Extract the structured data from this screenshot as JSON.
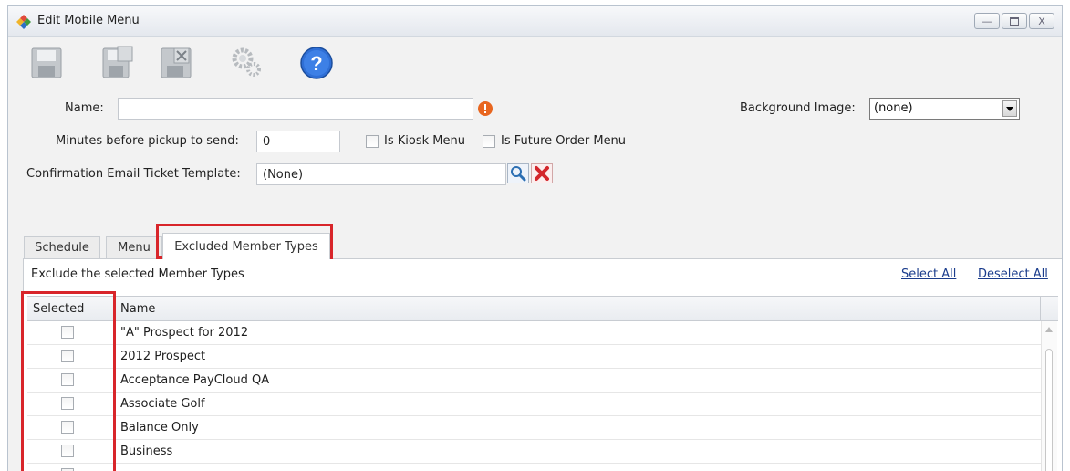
{
  "window": {
    "title": "Edit Mobile Menu",
    "buttons": [
      "minimize",
      "maximize",
      "close"
    ]
  },
  "toolbar": {
    "icons": [
      "save-icon",
      "save-new-icon",
      "save-close-icon",
      "settings-icon",
      "help-icon"
    ],
    "help_glyph": "?"
  },
  "form": {
    "name_label": "Name:",
    "name_value": "",
    "bg_label": "Background Image:",
    "bg_value": "(none)",
    "minutes_label": "Minutes before pickup to send:",
    "minutes_value": "0",
    "kiosk_label": "Is Kiosk Menu",
    "future_label": "Is Future Order Menu",
    "email_label": "Confirmation Email Ticket Template:",
    "email_value": "(None)"
  },
  "tabs": [
    {
      "label": "Schedule"
    },
    {
      "label": "Menu"
    },
    {
      "label": "Excluded Member Types"
    }
  ],
  "panel": {
    "caption": "Exclude the selected Member Types",
    "select_all": "Select All",
    "deselect_all": "Deselect All",
    "col_selected": "Selected",
    "col_name": "Name",
    "rows": [
      {
        "name": "\"A\" Prospect for 2012",
        "selected": false
      },
      {
        "name": "2012 Prospect",
        "selected": false
      },
      {
        "name": "Acceptance PayCloud QA",
        "selected": false
      },
      {
        "name": "Associate Golf",
        "selected": false
      },
      {
        "name": "Balance Only",
        "selected": false
      },
      {
        "name": "Business",
        "selected": false
      }
    ]
  },
  "colors": {
    "highlight": "#d8252a",
    "link": "#1a3c8c",
    "help": "#2f6fd6"
  }
}
